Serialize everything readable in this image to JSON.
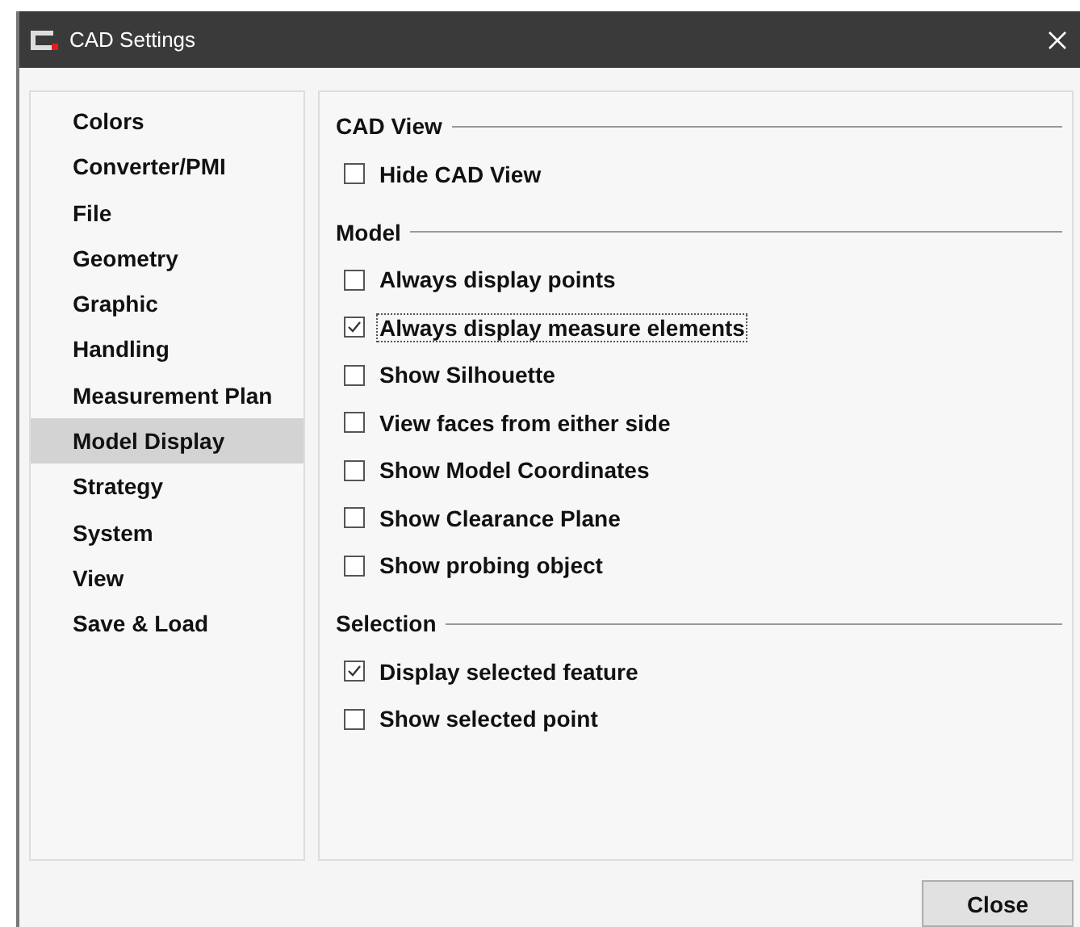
{
  "window": {
    "title": "CAD Settings"
  },
  "sidebar": {
    "items": [
      {
        "label": "Colors",
        "selected": false
      },
      {
        "label": "Converter/PMI",
        "selected": false
      },
      {
        "label": "File",
        "selected": false
      },
      {
        "label": "Geometry",
        "selected": false
      },
      {
        "label": "Graphic",
        "selected": false
      },
      {
        "label": "Handling",
        "selected": false
      },
      {
        "label": "Measurement Plan",
        "selected": false
      },
      {
        "label": "Model Display",
        "selected": true
      },
      {
        "label": "Strategy",
        "selected": false
      },
      {
        "label": "System",
        "selected": false
      },
      {
        "label": "View",
        "selected": false
      },
      {
        "label": "Save & Load",
        "selected": false
      }
    ]
  },
  "sections": [
    {
      "title": "CAD View",
      "options": [
        {
          "label": "Hide CAD View",
          "checked": false,
          "focused": false
        }
      ]
    },
    {
      "title": "Model",
      "options": [
        {
          "label": "Always display points",
          "checked": false,
          "focused": false
        },
        {
          "label": "Always display measure elements",
          "checked": true,
          "focused": true
        },
        {
          "label": "Show Silhouette",
          "checked": false,
          "focused": false
        },
        {
          "label": "View faces from either side",
          "checked": false,
          "focused": false
        },
        {
          "label": "Show Model Coordinates",
          "checked": false,
          "focused": false
        },
        {
          "label": "Show Clearance Plane",
          "checked": false,
          "focused": false
        },
        {
          "label": "Show probing object",
          "checked": false,
          "focused": false
        }
      ]
    },
    {
      "title": "Selection",
      "options": [
        {
          "label": "Display selected feature",
          "checked": true,
          "focused": false
        },
        {
          "label": "Show selected point",
          "checked": false,
          "focused": false
        }
      ]
    }
  ],
  "buttons": [
    "Close"
  ]
}
